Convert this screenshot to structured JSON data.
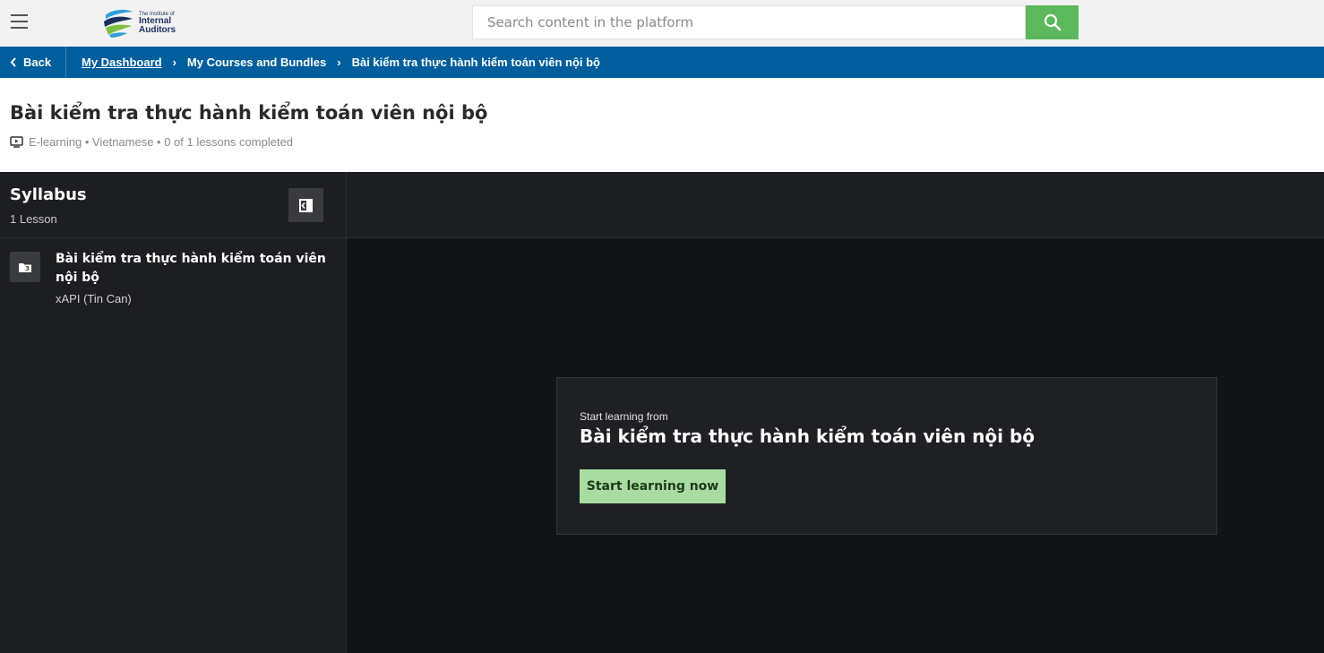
{
  "header": {
    "menu_icon": "hamburger-icon",
    "logo": {
      "line1": "The Institute of",
      "line2": "Internal",
      "line3": "Auditors",
      "colors": [
        "#2e9fd9",
        "#1b2f5e",
        "#7fbf3f"
      ]
    },
    "search": {
      "placeholder": "Search content in the platform",
      "value": "",
      "button_icon": "search-icon",
      "button_color": "#5cb85c"
    }
  },
  "breadcrumb": {
    "back_label": "Back",
    "items": [
      {
        "label": "My Dashboard"
      },
      {
        "label": "My Courses and Bundles"
      },
      {
        "label": "Bài kiểm tra thực hành kiểm toán viên nội bộ"
      }
    ],
    "separator": "›",
    "bar_color": "#005e9d"
  },
  "course": {
    "title": "Bài kiểm tra thực hành kiểm toán viên nội bộ",
    "meta_icon": "presentation-icon",
    "meta": "E-learning • Vietnamese • 0 of 1 lessons completed"
  },
  "syllabus": {
    "title": "Syllabus",
    "count": "1 Lesson",
    "collapse_icon": "collapse-panel-icon",
    "lessons": [
      {
        "icon": "folder-icon",
        "title": "Bài kiểm tra thực hành kiểm toán viên nội bộ",
        "type": "xAPI (Tin Can)"
      }
    ]
  },
  "start": {
    "label": "Start learning from",
    "title": "Bài kiểm tra thực hành kiểm toán viên nội bộ",
    "button": "Start learning now",
    "button_color": "#a8dca0"
  }
}
